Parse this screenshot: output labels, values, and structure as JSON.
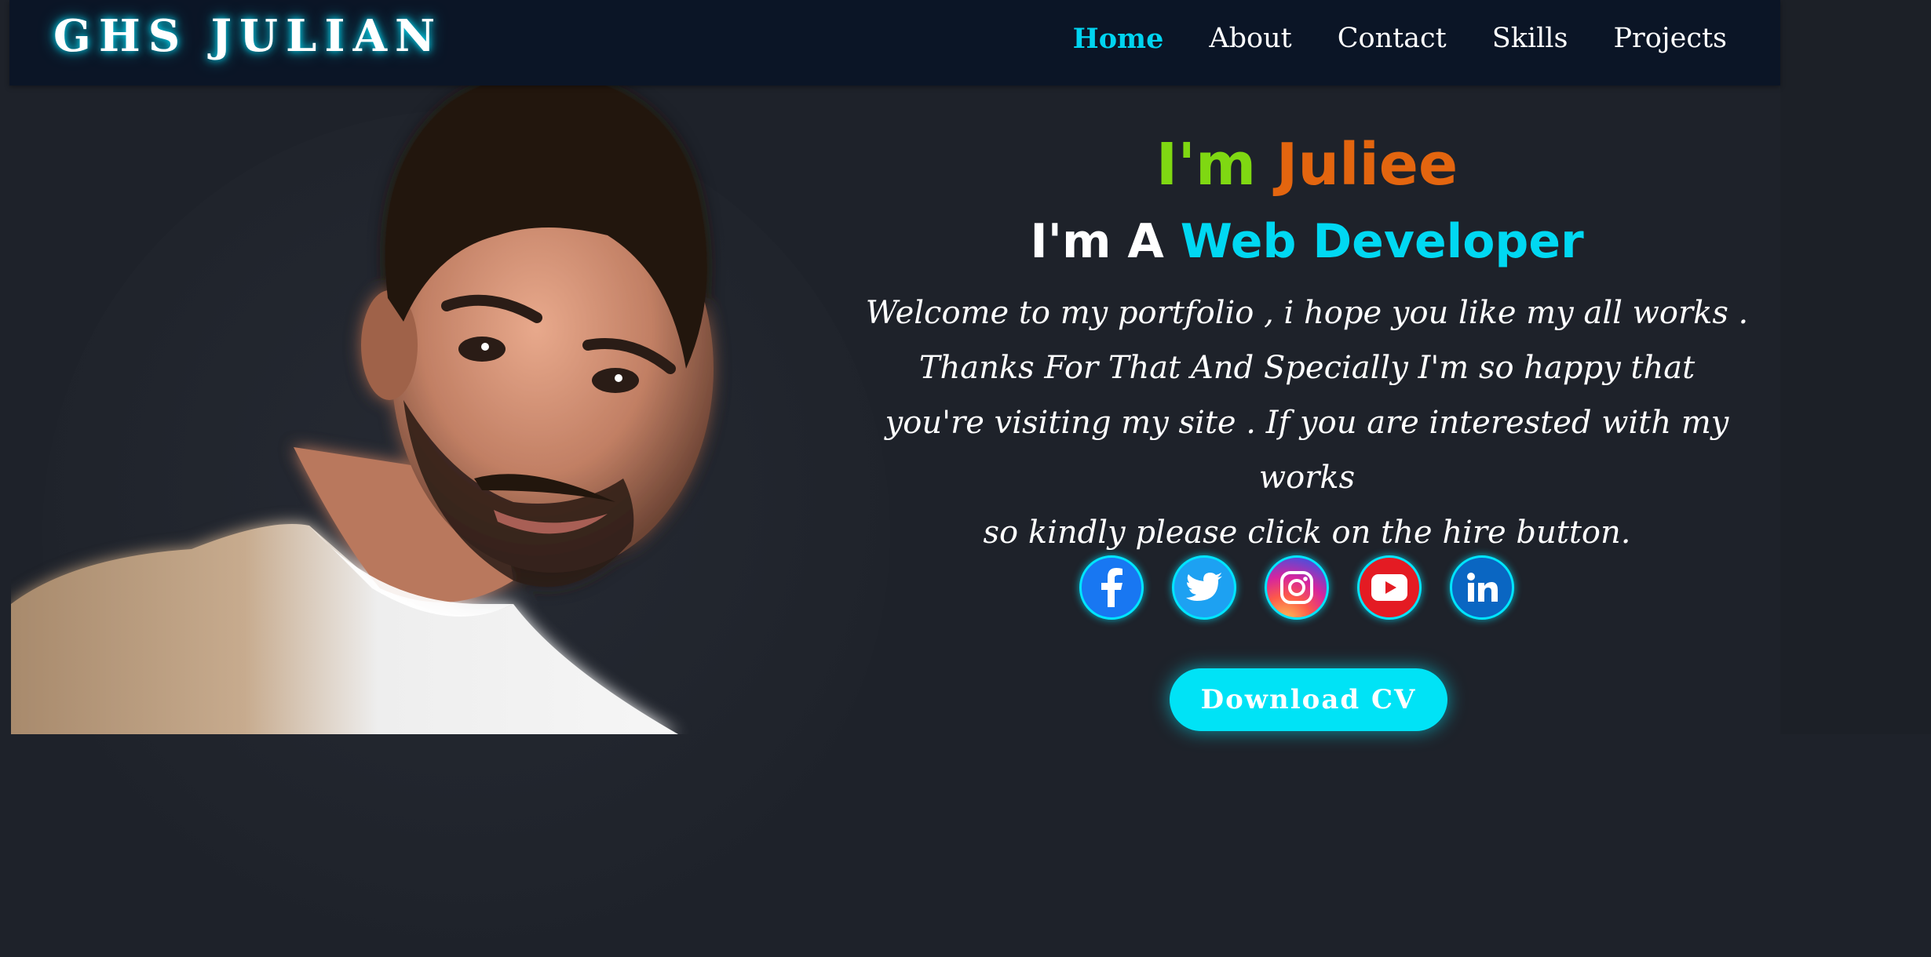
{
  "brand": {
    "logo": "GHS JULIAN"
  },
  "nav": {
    "items": [
      {
        "label": "Home",
        "active": true
      },
      {
        "label": "About",
        "active": false
      },
      {
        "label": "Contact",
        "active": false
      },
      {
        "label": "Skills",
        "active": false
      },
      {
        "label": "Projects",
        "active": false
      }
    ]
  },
  "hero": {
    "greeting_prefix": "I'm",
    "name": "Juliee",
    "role_prefix": "I'm A",
    "role": "Web Developer",
    "intro_lines": [
      "Welcome to my portfolio , i hope you like my all works .",
      "Thanks For That And Specially I'm so happy that",
      "you're visiting my site . If you are interested with my works",
      "so kindly please click on the hire button."
    ],
    "cv_button": "Download CV"
  },
  "socials": [
    {
      "name": "facebook-icon",
      "color": "#1877f2"
    },
    {
      "name": "twitter-icon",
      "color": "#1da1f2"
    },
    {
      "name": "instagram-icon",
      "color": "#d6249f"
    },
    {
      "name": "youtube-icon",
      "color": "#e41b23"
    },
    {
      "name": "linkedin-icon",
      "color": "#0a66c2"
    }
  ],
  "colors": {
    "accent": "#00e5ff",
    "greeting": "#7fd812",
    "name": "#e3650f",
    "nav_bg": "#0b1526",
    "page_bg": "#1e222a"
  }
}
